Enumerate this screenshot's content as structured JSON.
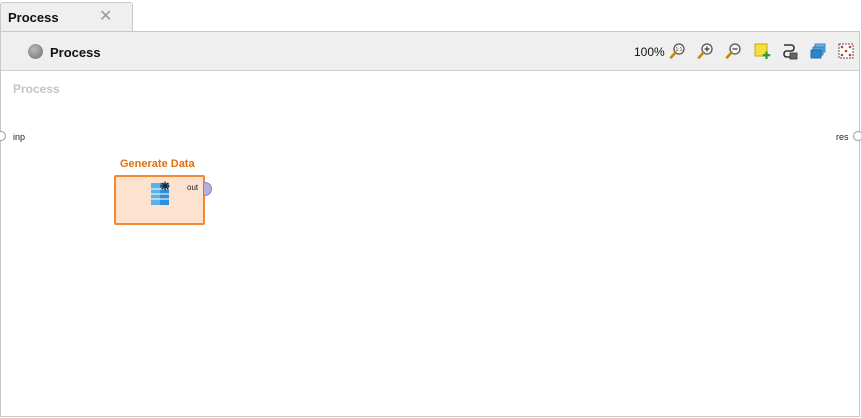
{
  "tab": {
    "label": "Process",
    "close_glyph": "✕"
  },
  "toolbar": {
    "title": "Process",
    "process_icon": "process-icon",
    "zoom": "100%",
    "icons": [
      "zoom-reset-icon",
      "zoom-in-icon",
      "zoom-out-icon",
      "add-note-icon",
      "auto-wire-icon",
      "layers-icon",
      "arrange-icon"
    ]
  },
  "canvas": {
    "title": "Process",
    "left_port": "inp",
    "right_port": "res"
  },
  "operator": {
    "name": "Generate Data",
    "icon": "generate-data-icon",
    "output_port": "out",
    "accent_color": "#f08a33",
    "fill_color": "#fde2d0"
  }
}
